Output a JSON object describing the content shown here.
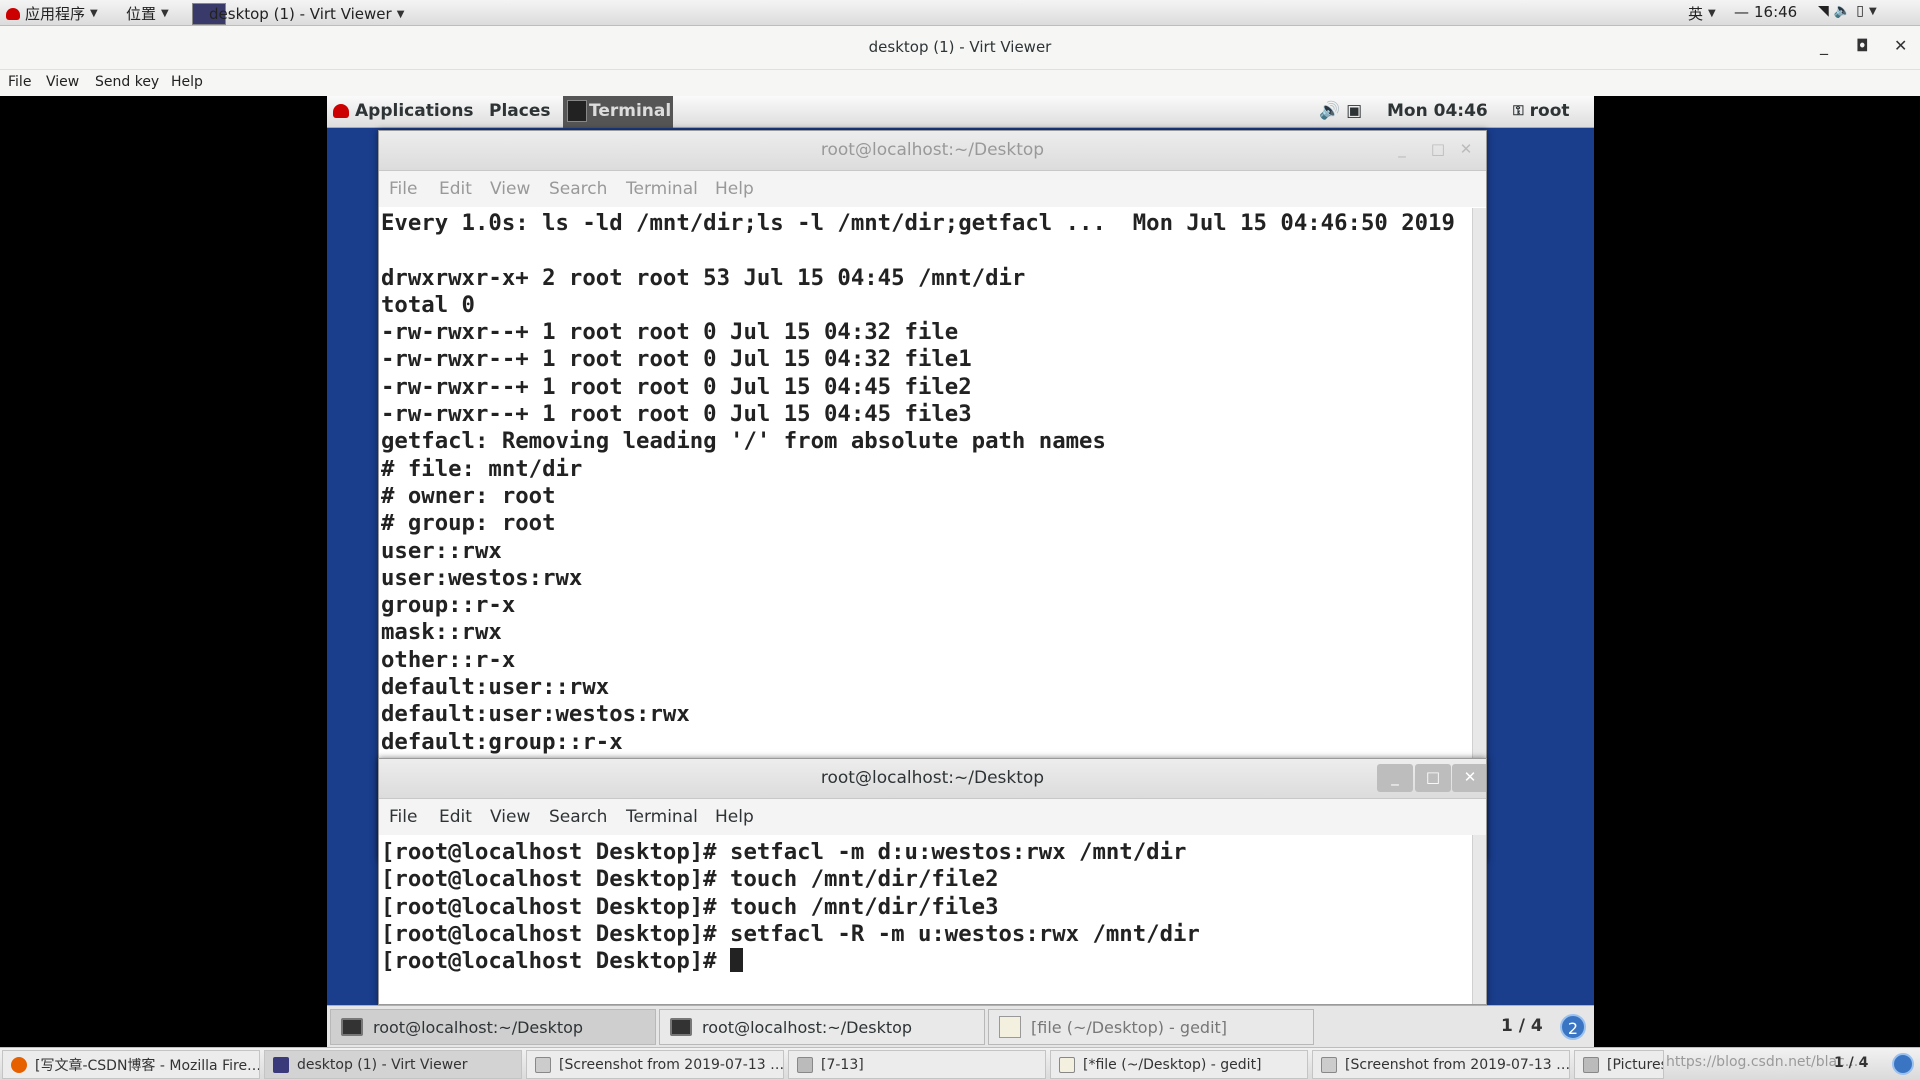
{
  "host_topbar": {
    "applications": "应用程序",
    "places": "位置",
    "active_app": "desktop (1) - Virt Viewer",
    "input_method": "英",
    "clock": "16:46"
  },
  "virt_viewer": {
    "title": "desktop (1) - Virt Viewer",
    "menu": [
      "File",
      "View",
      "Send key",
      "Help"
    ]
  },
  "guest_topbar": {
    "applications": "Applications",
    "places": "Places",
    "terminal": "Terminal",
    "clock": "Mon 04:46",
    "user": "root"
  },
  "terminal_back": {
    "title": "root@localhost:~/Desktop",
    "menu": [
      "File",
      "Edit",
      "View",
      "Search",
      "Terminal",
      "Help"
    ],
    "lines": [
      "Every 1.0s: ls -ld /mnt/dir;ls -l /mnt/dir;getfacl ...  Mon Jul 15 04:46:50 2019",
      "",
      "drwxrwxr-x+ 2 root root 53 Jul 15 04:45 /mnt/dir",
      "total 0",
      "-rw-rwxr--+ 1 root root 0 Jul 15 04:32 file",
      "-rw-rwxr--+ 1 root root 0 Jul 15 04:32 file1",
      "-rw-rwxr--+ 1 root root 0 Jul 15 04:45 file2",
      "-rw-rwxr--+ 1 root root 0 Jul 15 04:45 file3",
      "getfacl: Removing leading '/' from absolute path names",
      "# file: mnt/dir",
      "# owner: root",
      "# group: root",
      "user::rwx",
      "user:westos:rwx",
      "group::r-x",
      "mask::rwx",
      "other::r-x",
      "default:user::rwx",
      "default:user:westos:rwx",
      "default:group::r-x"
    ]
  },
  "terminal_front": {
    "title": "root@localhost:~/Desktop",
    "menu": [
      "File",
      "Edit",
      "View",
      "Search",
      "Terminal",
      "Help"
    ],
    "lines": [
      "[root@localhost Desktop]# setfacl -m d:u:westos:rwx /mnt/dir",
      "[root@localhost Desktop]# touch /mnt/dir/file2",
      "[root@localhost Desktop]# touch /mnt/dir/file3",
      "[root@localhost Desktop]# setfacl -R -m u:westos:rwx /mnt/dir"
    ],
    "prompt": "[root@localhost Desktop]# "
  },
  "guest_taskbar": {
    "tasks": [
      "root@localhost:~/Desktop",
      "root@localhost:~/Desktop",
      "[file (~/Desktop) - gedit]"
    ],
    "pager": "1 / 4",
    "notifications": "2"
  },
  "host_taskbar": {
    "tasks": [
      "[写文章-CSDN博客 - Mozilla Fire…",
      "desktop (1) - Virt Viewer",
      "[Screenshot from 2019-07-13 …",
      "[7-13]",
      "[*file (~/Desktop) - gedit]",
      "[Screenshot from 2019-07-13 …",
      "[Pictures]"
    ],
    "watermark": "https://blog.csdn.net/blac...",
    "pager": "1 / 4"
  }
}
